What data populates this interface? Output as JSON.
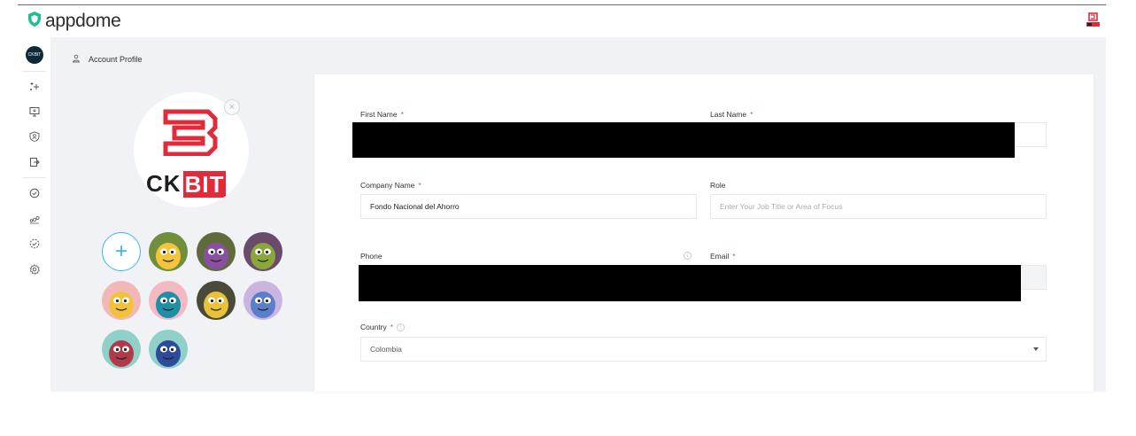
{
  "app": {
    "brand": "appdome"
  },
  "sidebar": {
    "avatar_text": "CKBIT"
  },
  "breadcrumb": {
    "title": "Account Profile"
  },
  "profile": {
    "logo_ck": "CK",
    "logo_bit": "BIT",
    "remove_symbol": "×",
    "add_avatar_symbol": "+"
  },
  "form": {
    "first_name": {
      "label": "First Name",
      "required": "*"
    },
    "last_name": {
      "label": "Last Name",
      "required": "*"
    },
    "company_name": {
      "label": "Company Name",
      "required": "*",
      "value": "Fondo Nacional del Ahorro"
    },
    "role": {
      "label": "Role",
      "placeholder": "Enter Your Job Title or Area of Focus"
    },
    "phone": {
      "label": "Phone",
      "info": "i"
    },
    "email": {
      "label": "Email",
      "required": "*"
    },
    "country": {
      "label": "Country",
      "required": "*",
      "info": "i",
      "value": "Colombia"
    }
  },
  "colors": {
    "brand_green": "#1fbf8f",
    "accent_blue": "#41b6d8",
    "logo_red": "#e02b3b",
    "required_red": "#e24b4b"
  },
  "avatars": [
    {
      "name": "yellow-glasses-monster",
      "bg": "#6f8f3c",
      "fg": "#f3c53a"
    },
    {
      "name": "purple-monster",
      "bg": "#5f6b3a",
      "fg": "#8a4fa0"
    },
    {
      "name": "green-monster",
      "bg": "#6a4b6b",
      "fg": "#8aa83a"
    },
    {
      "name": "glasses-girl-monster",
      "bg": "#f2b8b8",
      "fg": "#f1c33c"
    },
    {
      "name": "blue-antenna-monster",
      "bg": "#f4b9c2",
      "fg": "#1f8fa8"
    },
    {
      "name": "yellow-dark-monster",
      "bg": "#4a4a3a",
      "fg": "#e9c23a"
    },
    {
      "name": "blue-round-monster",
      "bg": "#c9b5e0",
      "fg": "#5a7ec9"
    },
    {
      "name": "red-monster",
      "bg": "#8fd1c9",
      "fg": "#b03a4a"
    },
    {
      "name": "dark-blue-monster",
      "bg": "#8fd1c9",
      "fg": "#2f4a9a"
    }
  ]
}
